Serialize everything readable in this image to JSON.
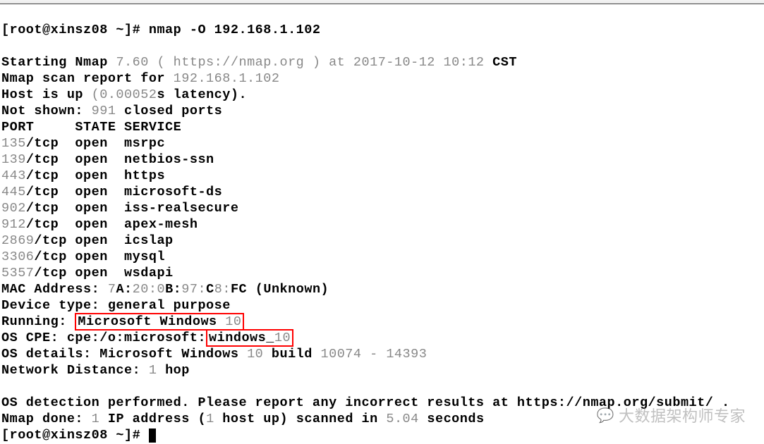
{
  "prompt1": "[root@xinsz08 ~]# ",
  "command": "nmap -O 192.168.1.102",
  "lines": {
    "starting_a": "Starting Nmap ",
    "starting_b": "7.60 ( https://nmap.org ) at 2017-10-12 10:12 ",
    "starting_c": "CST",
    "report_a": "Nmap scan report for ",
    "report_b": "192.168.1.102",
    "hostup_a": "Host is up ",
    "hostup_b": "(0.00052",
    "hostup_c": "s latency).",
    "notshown_a": "Not shown: ",
    "notshown_b": "991 ",
    "notshown_c": "closed ports",
    "header": "PORT     STATE SERVICE"
  },
  "ports": [
    {
      "num": "135",
      "proto": "/tcp  open  msrpc"
    },
    {
      "num": "139",
      "proto": "/tcp  open  netbios-ssn"
    },
    {
      "num": "443",
      "proto": "/tcp  open  https"
    },
    {
      "num": "445",
      "proto": "/tcp  open  microsoft-ds"
    },
    {
      "num": "902",
      "proto": "/tcp  open  iss-realsecure"
    },
    {
      "num": "912",
      "proto": "/tcp  open  apex-mesh"
    },
    {
      "num": "2869",
      "proto": "/tcp open  icslap"
    },
    {
      "num": "3306",
      "proto": "/tcp open  mysql"
    },
    {
      "num": "5357",
      "proto": "/tcp open  wsdapi"
    }
  ],
  "mac_a": "MAC Address: ",
  "mac_b": "7",
  "mac_c": "A:",
  "mac_d": "20:0",
  "mac_e": "B:",
  "mac_f": "97:",
  "mac_g": "C",
  "mac_h": "8:",
  "mac_i": "FC (Unknown)",
  "device": "Device type: general purpose",
  "running_a": "Running: ",
  "running_box_a": "Microsoft Windows ",
  "running_box_b": "10",
  "cpe_a": "OS CPE: cpe:/o:microsoft:",
  "cpe_box_a": "windows_",
  "cpe_box_b": "10",
  "details_a": "OS details: Microsoft Windows ",
  "details_b": "10 ",
  "details_c": "build ",
  "details_d": "10074 - 14393",
  "distance_a": "Network Distance: ",
  "distance_b": "1 ",
  "distance_c": "hop",
  "footer_a": "OS detection performed. Please report any incorrect results at https://nmap.org/submit/ .",
  "done_a": "Nmap done: ",
  "done_b": "1 ",
  "done_c": "IP address (",
  "done_d": "1 ",
  "done_e": "host up) scanned in ",
  "done_f": "5.04 ",
  "done_g": "seconds",
  "prompt2": "[root@xinsz08 ~]# ",
  "watermark": "大数据架构师专家"
}
